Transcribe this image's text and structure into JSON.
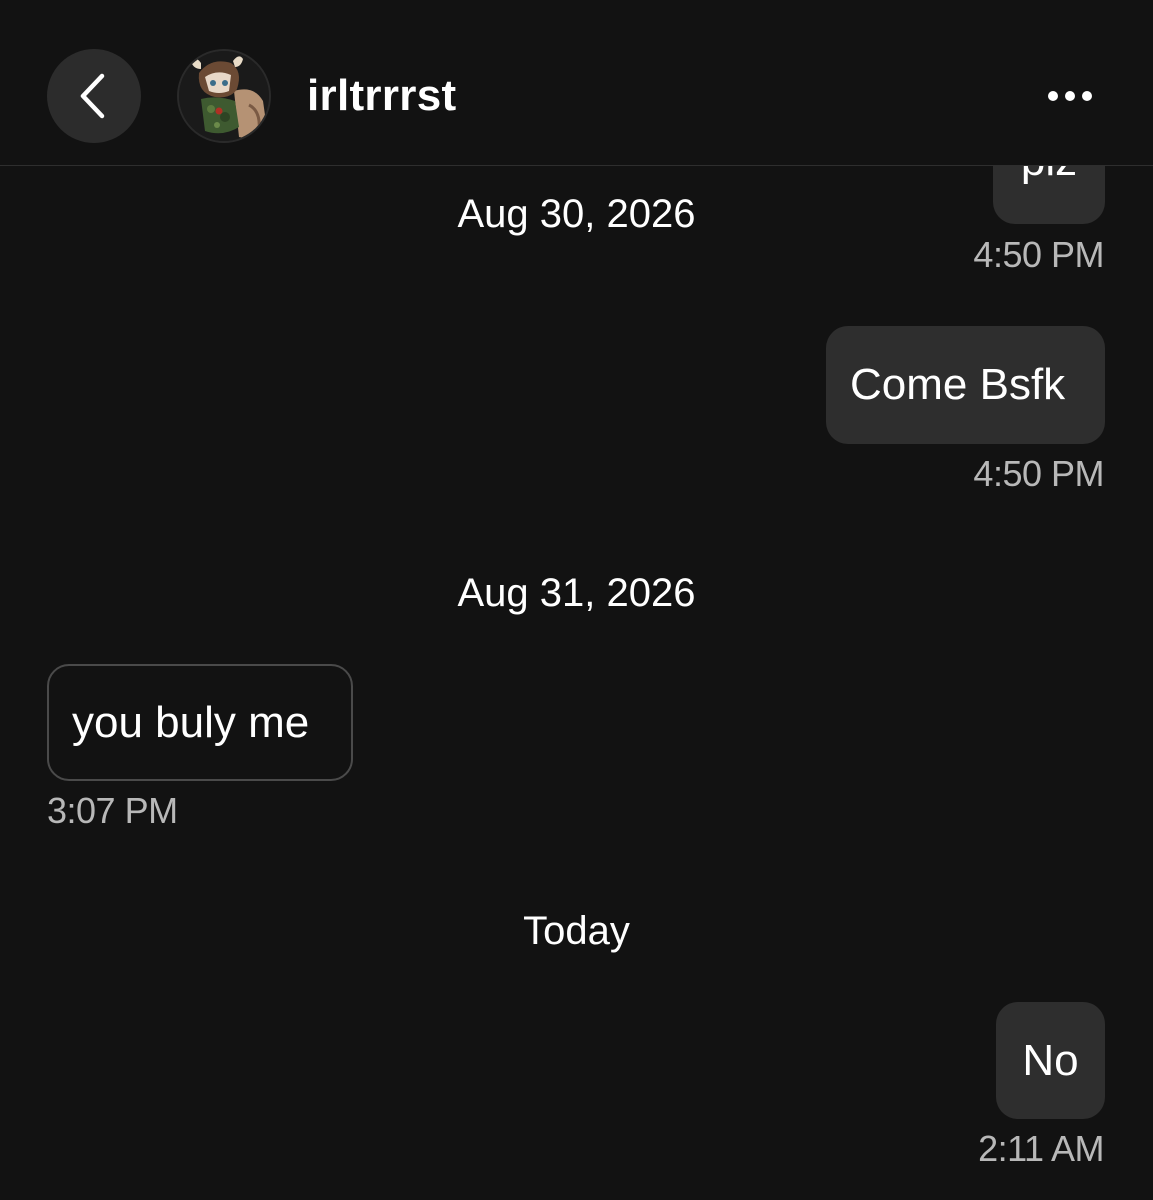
{
  "header": {
    "back_icon": "chevron-left-icon",
    "username": "irltrrrst",
    "more_icon": "ellipsis-horizontal-icon"
  },
  "messages": [
    {
      "direction": "outgoing",
      "text": "plz",
      "time": "4:50 PM"
    },
    {
      "direction": "outgoing",
      "text": "Come Bsfk",
      "time": "4:50 PM"
    },
    {
      "direction": "incoming",
      "text": "you buly me",
      "time": "3:07 PM"
    },
    {
      "direction": "outgoing",
      "text": "No",
      "time": "2:11 AM"
    }
  ],
  "dates": [
    "Aug 30, 2026",
    "Aug 31, 2026",
    "Today"
  ],
  "colors": {
    "background": "#121212",
    "outgoing_bubble": "#2e2e2e",
    "incoming_border": "#4a4a4a",
    "timestamp": "#b8b8b8"
  }
}
